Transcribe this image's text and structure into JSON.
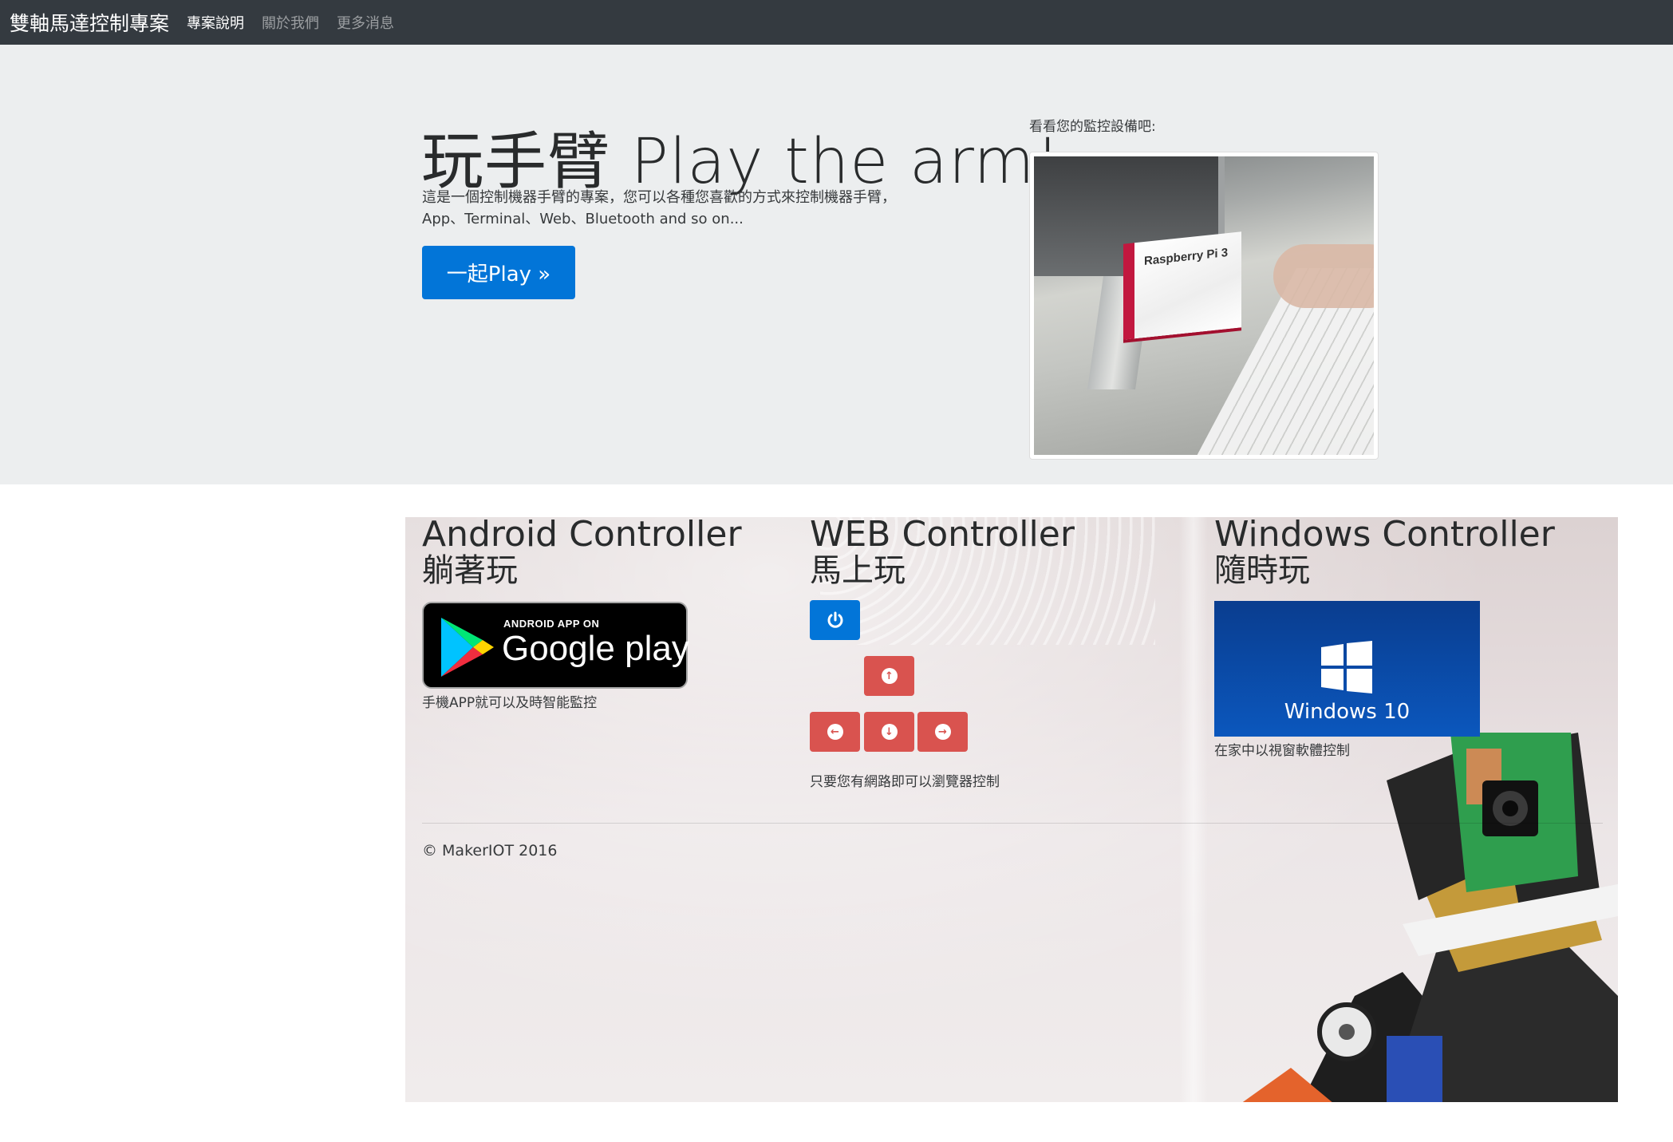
{
  "navbar": {
    "brand": "雙軸馬達控制專案",
    "links": [
      {
        "label": "專案說明",
        "active": true
      },
      {
        "label": "關於我們",
        "active": false
      },
      {
        "label": "更多消息",
        "active": false
      }
    ]
  },
  "hero": {
    "title": "玩手臂 Play the arm!",
    "desc_line1": "這是一個控制機器手臂的專案，您可以各種您喜歡的方式來控制機器手臂，",
    "desc_line2": "App、Terminal、Web、Bluetooth and so on...",
    "button_label": "一起Play »"
  },
  "monitor": {
    "label": "看看您的監控設備吧:",
    "image_text": "Raspberry Pi 3"
  },
  "controllers": {
    "android": {
      "title": "Android Controller",
      "subtitle": "躺著玩",
      "badge_small": "ANDROID APP ON",
      "badge_big": "Google play",
      "caption": "手機APP就可以及時智能監控"
    },
    "web": {
      "title": "WEB Controller",
      "subtitle": "馬上玩",
      "power_icon": "power-icon",
      "arrows": [
        "arrow-up-icon",
        "arrow-left-icon",
        "arrow-down-icon",
        "arrow-right-icon"
      ],
      "caption": "只要您有網路即可以瀏覽器控制"
    },
    "windows": {
      "title": "Windows Controller",
      "subtitle": "隨時玩",
      "tile_text": "Windows 10",
      "caption": "在家中以視窗軟體控制"
    }
  },
  "footer": {
    "copyright": "© MakerIOT 2016"
  },
  "colors": {
    "navbar": "#343a40",
    "primary": "#0275d8",
    "danger": "#d9534f",
    "jumbotron": "#eceeef"
  }
}
